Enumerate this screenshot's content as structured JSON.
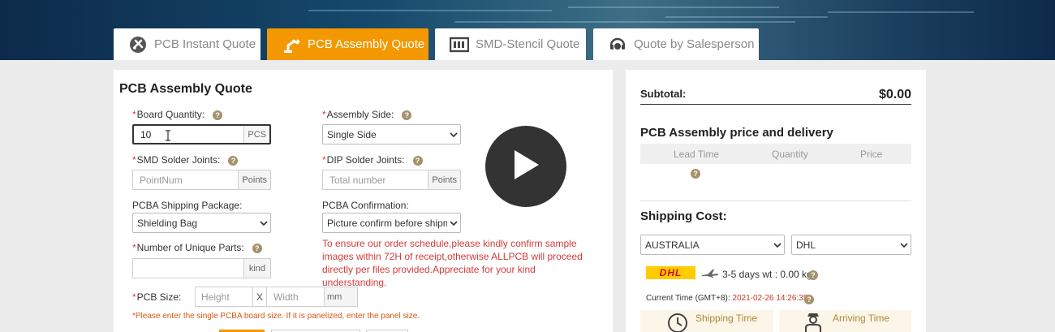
{
  "tabs": [
    {
      "label": "PCB Instant Quote",
      "icon": "pcb-board-icon",
      "active": false
    },
    {
      "label": "PCB Assembly Quote",
      "icon": "robot-arm-icon",
      "active": true
    },
    {
      "label": "SMD-Stencil Quote",
      "icon": "stencil-icon",
      "active": false
    },
    {
      "label": "Quote by Salesperson",
      "icon": "headset-icon",
      "active": false
    }
  ],
  "form": {
    "title": "PCB Assembly Quote",
    "board_quantity": {
      "label": "Board Quantity:",
      "value": "10",
      "unit": "PCS"
    },
    "assembly_side": {
      "label": "Assembly Side:",
      "value": "Single Side"
    },
    "smd_joints": {
      "label": "SMD Solder Joints:",
      "placeholder": "PointNum",
      "unit": "Points"
    },
    "dip_joints": {
      "label": "DIP Solder Joints:",
      "placeholder": "Total number",
      "unit": "Points"
    },
    "shipping_package": {
      "label": "PCBA Shipping Package:",
      "value": "Shielding Bag"
    },
    "confirmation": {
      "label": "PCBA Confirmation:",
      "value": "Picture confirm before shipment"
    },
    "unique_parts": {
      "label": "Number of Unique Parts:",
      "unit": "kind"
    },
    "warning": "To ensure our order schedule,please kindly confirm sample images within 72H of receipt,otherwise ALLPCB will proceed directly per files provided.Appreciate for your kind understanding.",
    "pcb_size": {
      "label": "PCB Size:",
      "height_placeholder": "Height",
      "sep": "X",
      "width_placeholder": "Width",
      "unit": "mm"
    },
    "size_note": "*Please enter the single PCBA board size. If it is panelized, enter the panel size."
  },
  "summary": {
    "subtotal_label": "Subtotal:",
    "subtotal_value": "$0.00",
    "price_title": "PCB Assembly price and delivery",
    "columns": [
      "Lead Time",
      "Quantity",
      "Price"
    ],
    "shipping_title": "Shipping Cost:",
    "country": "AUSTRALIA",
    "carrier": "DHL",
    "carrier_logo": "DHL",
    "transit": "3-5 days wt : 0.00 kg",
    "time_label": "Current Time (GMT+8):",
    "time_value": "2021-02-26 14:26:35",
    "shipping_time": "Shipping Time",
    "arriving_time": "Arriving Time"
  },
  "colors": {
    "accent": "#f39800",
    "warning": "#d43b3b",
    "help": "#a6926a",
    "dhl_yellow": "#ffcc00",
    "dhl_red": "#d40511"
  }
}
